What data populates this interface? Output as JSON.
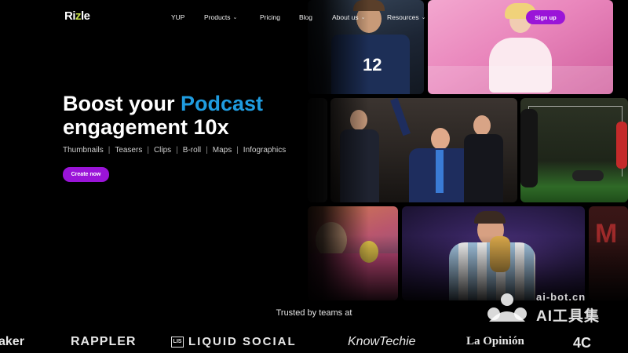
{
  "brand": {
    "logo_prefix": "Ri",
    "logo_accent": "z",
    "logo_suffix": "le"
  },
  "nav": {
    "items": [
      {
        "label": "YUP",
        "has_dropdown": false
      },
      {
        "label": "Products",
        "has_dropdown": true
      },
      {
        "label": "Pricing",
        "has_dropdown": false
      },
      {
        "label": "Blog",
        "has_dropdown": false
      },
      {
        "label": "About us",
        "has_dropdown": true
      },
      {
        "label": "Resources",
        "has_dropdown": true
      }
    ],
    "chevron_icon": "chevron-down-icon",
    "signup_label": "Sign up"
  },
  "hero": {
    "title_part1": "Boost your ",
    "title_highlight": "Podcast",
    "title_line2": "engagement 10x",
    "features": [
      "Thumbnails",
      "Teasers",
      "Clips",
      "B-roll",
      "Maps",
      "Infographics"
    ],
    "separator": "|",
    "cta_label": "Create now"
  },
  "trusted": {
    "heading": "Trusted by teams at",
    "brands": [
      "aker",
      "RAPPLER",
      "LIQUID SOCIAL",
      "KnowTechie",
      "La Opinión",
      "4C"
    ],
    "liquid_badge": "LIS"
  },
  "watermark": {
    "site": "ai-bot.cn",
    "name": "AI工具集"
  },
  "colors": {
    "accent_purple": "#9a14d8",
    "highlight_blue": "#1f9ce0",
    "logo_green": "#c7e14a",
    "background": "#000000"
  }
}
